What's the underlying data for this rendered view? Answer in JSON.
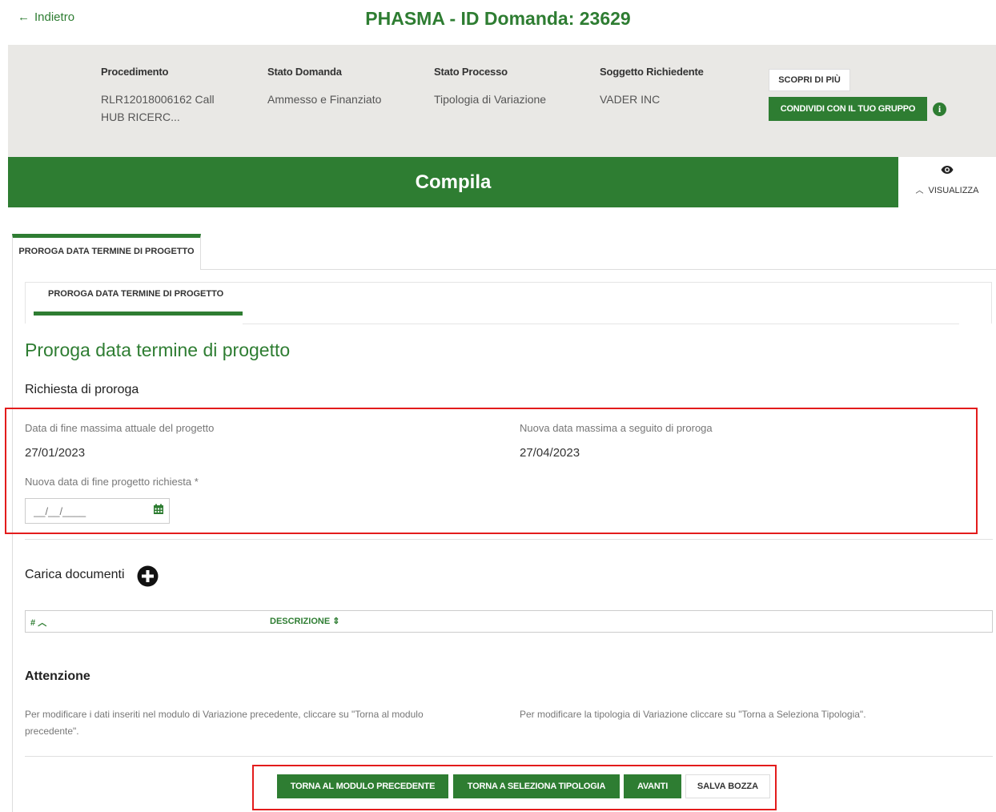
{
  "header": {
    "back_label": "Indietro",
    "title": "PHASMA - ID Domanda: 23629"
  },
  "info": {
    "procedimento_label": "Procedimento",
    "procedimento_value": "RLR12018006162 Call HUB RICERC...",
    "stato_domanda_label": "Stato Domanda",
    "stato_domanda_value": "Ammesso e Finanziato",
    "stato_processo_label": "Stato Processo",
    "stato_processo_value": "Tipologia di Variazione",
    "soggetto_label": "Soggetto Richiedente",
    "soggetto_value": "VADER INC",
    "scopri_label": "SCOPRI DI PIÙ",
    "condividi_label": "CONDIVIDI CON IL TUO GRUPPO"
  },
  "compila_bar": {
    "title": "Compila",
    "visualizza_label": "VISUALIZZA"
  },
  "tabs": {
    "main_tab": "PROROGA DATA TERMINE DI PROGETTO",
    "sub_tab": "PROROGA DATA TERMINE DI PROGETTO"
  },
  "form": {
    "section_title": "Proroga data termine di progetto",
    "subsection_title": "Richiesta di proroga",
    "current_end_label": "Data di fine massima attuale del progetto",
    "current_end_value": "27/01/2023",
    "new_max_label": "Nuova data massima a seguito di proroga",
    "new_max_value": "27/04/2023",
    "requested_label": "Nuova data di fine progetto richiesta *",
    "requested_placeholder": "__/__/____"
  },
  "documents": {
    "title": "Carica documenti",
    "col_index": "#",
    "col_descrizione": "DESCRIZIONE"
  },
  "attenzione": {
    "title": "Attenzione",
    "note_left": "Per modificare i dati inseriti nel modulo di Variazione precedente, cliccare su \"Torna al modulo precedente\".",
    "note_right": "Per modificare la tipologia di Variazione cliccare su \"Torna a Seleziona Tipologia\"."
  },
  "buttons": {
    "torna_modulo": "TORNA AL MODULO PRECEDENTE",
    "torna_tipologia": "TORNA A SELEZIONA TIPOLOGIA",
    "avanti": "AVANTI",
    "salva_bozza": "SALVA BOZZA"
  },
  "colors": {
    "brand_green": "#2e7d32",
    "highlight_red": "#e31c1c",
    "info_band_bg": "#e9e8e5"
  },
  "icons": [
    "back-arrow-icon",
    "info-icon",
    "eye-icon",
    "chevron-up-icon",
    "calendar-icon",
    "plus-circle-icon",
    "sort-icon"
  ]
}
